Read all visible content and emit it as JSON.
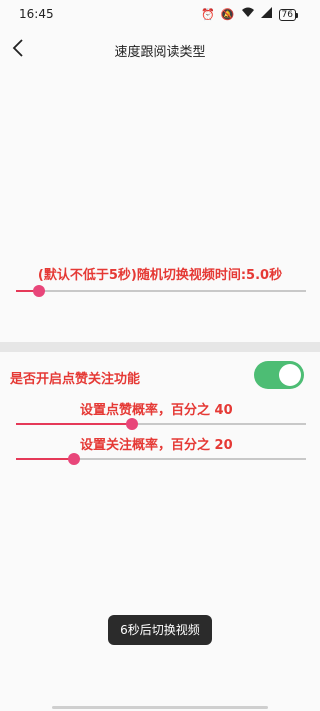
{
  "status_bar": {
    "time": "16:45",
    "battery": "76"
  },
  "nav": {
    "title": "速度跟阅读类型"
  },
  "random_switch": {
    "label": "(默认不低于5秒)随机切换视频时间:5.0秒",
    "slider_fraction": 0.08
  },
  "like_follow": {
    "toggle_label": "是否开启点赞关注功能",
    "toggle_on": true,
    "like_prob_label": "设置点赞概率，百分之 40",
    "like_prob_value": 40,
    "follow_prob_label": "设置关注概率，百分之 20",
    "follow_prob_value": 20
  },
  "toast": {
    "text": "6秒后切换视频"
  },
  "colors": {
    "accent_text": "#e53935",
    "slider_thumb": "#e8467a",
    "toggle_on": "#4dbd74"
  }
}
